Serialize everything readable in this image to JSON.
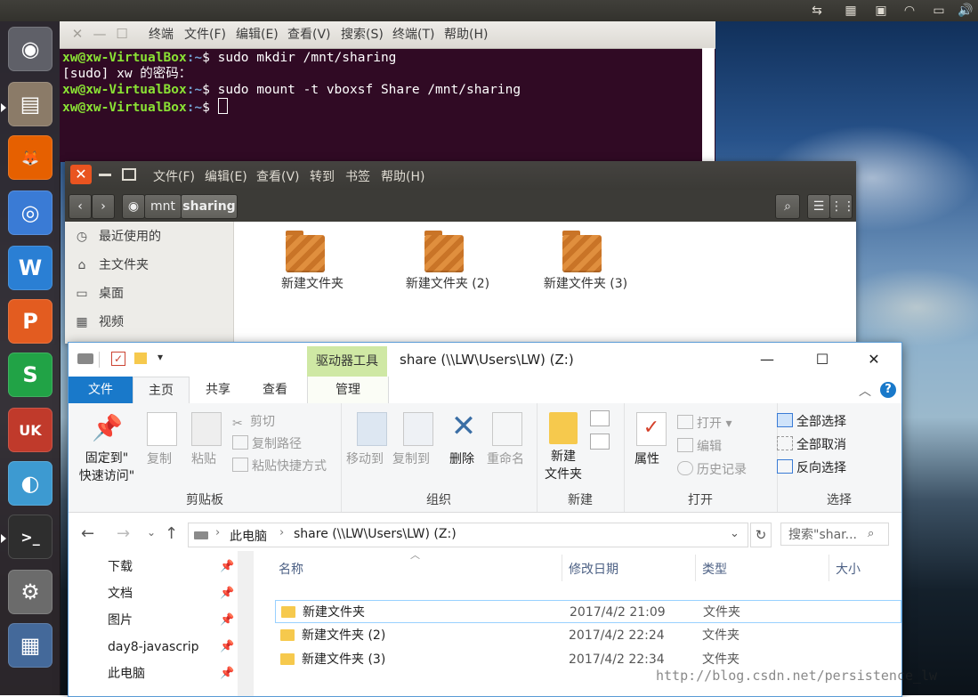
{
  "top_panel": {
    "icons": [
      "keyboard-layout-icon",
      "input-method-icon",
      "calendar-icon",
      "wifi-icon",
      "battery-icon",
      "volume-icon"
    ]
  },
  "launcher": {
    "apps": [
      {
        "name": "ubuntu-dash",
        "color": "#5f6068",
        "glyph": "◉"
      },
      {
        "name": "files",
        "color": "#8b7b68",
        "glyph": "▤"
      },
      {
        "name": "firefox",
        "color": "#e66000",
        "glyph": "🦊"
      },
      {
        "name": "chromium",
        "color": "#3a7bd5",
        "glyph": "◎"
      },
      {
        "name": "wps-writer",
        "color": "#2a7fd4",
        "glyph": "W"
      },
      {
        "name": "wps-presentation",
        "color": "#e35c20",
        "glyph": "P"
      },
      {
        "name": "wps-spreadsheet",
        "color": "#21a346",
        "glyph": "S"
      },
      {
        "name": "ubuntu-software",
        "color": "#c03a2b",
        "glyph": "UK"
      },
      {
        "name": "remmina",
        "color": "#3d9ad1",
        "glyph": "◐"
      },
      {
        "name": "terminal",
        "color": "#2e2e2e",
        "glyph": ">_"
      },
      {
        "name": "system-settings",
        "color": "#6b6b6b",
        "glyph": "⚙"
      },
      {
        "name": "workspace-switcher",
        "color": "#44699a",
        "glyph": "▦"
      }
    ]
  },
  "terminal": {
    "menu": [
      "终端",
      "文件(F)",
      "编辑(E)",
      "查看(V)",
      "搜索(S)",
      "终端(T)",
      "帮助(H)"
    ],
    "lines": [
      {
        "prompt": "xw@xw-VirtualBox",
        "path": ":~",
        "cmd": "$ sudo mkdir /mnt/sharing"
      },
      {
        "plain": "[sudo] xw 的密码："
      },
      {
        "prompt": "xw@xw-VirtualBox",
        "path": ":~",
        "cmd": "$ sudo mount -t vboxsf Share /mnt/sharing"
      },
      {
        "prompt": "xw@xw-VirtualBox",
        "path": ":~",
        "cmd": "$ "
      }
    ],
    "colors": {
      "bg": "#300a24",
      "prompt": "#8ae234",
      "path": "#729fcf"
    }
  },
  "nautilus": {
    "menu": [
      "文件(F)",
      "编辑(E)",
      "查看(V)",
      "转到",
      "书签",
      "帮助(H)"
    ],
    "path": [
      "mnt",
      "sharing"
    ],
    "sidebar": [
      {
        "icon": "clock-icon",
        "label": "最近使用的"
      },
      {
        "icon": "home-icon",
        "label": "主文件夹"
      },
      {
        "icon": "desktop-icon",
        "label": "桌面"
      },
      {
        "icon": "video-icon",
        "label": "视频"
      }
    ],
    "folders": [
      "新建文件夹",
      "新建文件夹 (2)",
      "新建文件夹 (3)"
    ]
  },
  "explorer": {
    "title": "share (\\\\LW\\Users\\LW) (Z:)",
    "drive_tools": "驱动器工具",
    "tabs": {
      "file": "文件",
      "home": "主页",
      "share": "共享",
      "view": "查看",
      "manage": "管理"
    },
    "ribbon": {
      "clipboard": {
        "label": "剪贴板",
        "pin": "固定到\"\n快速访问\"",
        "copy": "复制",
        "paste": "粘贴",
        "cut": "剪切",
        "copy_path": "复制路径",
        "paste_shortcut": "粘贴快捷方式"
      },
      "organize": {
        "label": "组织",
        "move_to": "移动到",
        "copy_to": "复制到",
        "delete": "删除",
        "rename": "重命名"
      },
      "new": {
        "label": "新建",
        "new_folder": "新建\n文件夹"
      },
      "open": {
        "label": "打开",
        "properties": "属性",
        "open": "打开",
        "edit": "编辑",
        "history": "历史记录"
      },
      "select": {
        "label": "选择",
        "select_all": "全部选择",
        "select_none": "全部取消",
        "invert": "反向选择"
      }
    },
    "address": {
      "pc": "此电脑",
      "share": "share (\\\\LW\\Users\\LW) (Z:)"
    },
    "search_placeholder": "搜索\"shar...",
    "nav": [
      {
        "label": "下载",
        "pinned": true
      },
      {
        "label": "文档",
        "pinned": true
      },
      {
        "label": "图片",
        "pinned": true
      },
      {
        "label": "day8-javascrip",
        "pinned": true
      },
      {
        "label": "此电脑",
        "pinned": true
      }
    ],
    "columns": {
      "name": "名称",
      "date": "修改日期",
      "type": "类型",
      "size": "大小"
    },
    "rows": [
      {
        "name": "新建文件夹",
        "date": "2017/4/2 21:09",
        "type": "文件夹"
      },
      {
        "name": "新建文件夹 (2)",
        "date": "2017/4/2 22:24",
        "type": "文件夹"
      },
      {
        "name": "新建文件夹 (3)",
        "date": "2017/4/2 22:34",
        "type": "文件夹"
      }
    ]
  },
  "watermark": "http://blog.csdn.net/persistence_lw"
}
